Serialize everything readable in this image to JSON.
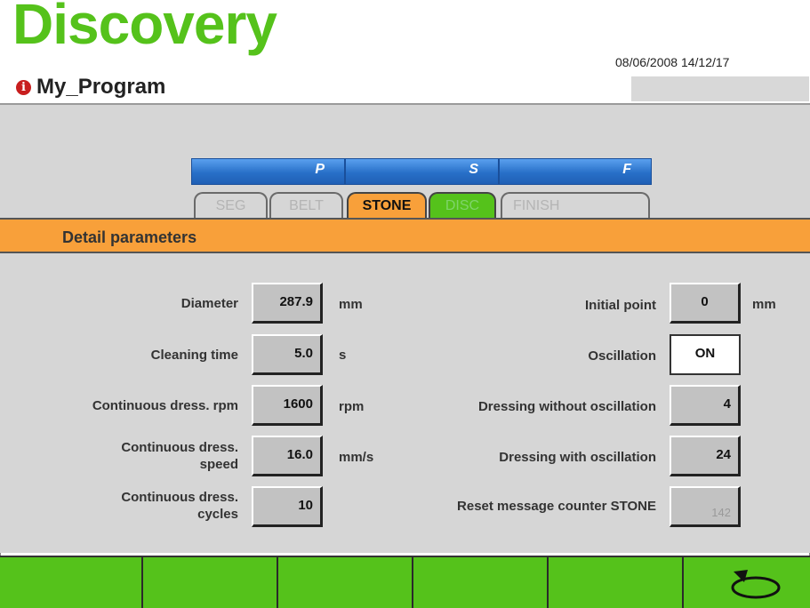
{
  "app": {
    "title": "Discovery"
  },
  "program": {
    "name": "My_Program",
    "icon": "info-icon"
  },
  "datetime": "08/06/2008 14/12/17",
  "tab_groups": [
    {
      "label": "P"
    },
    {
      "label": "S"
    },
    {
      "label": "F"
    }
  ],
  "tabs": [
    {
      "label": "SEG",
      "state": "inactive"
    },
    {
      "label": "BELT",
      "state": "inactive"
    },
    {
      "label": "STONE",
      "state": "active"
    },
    {
      "label": "DISC",
      "state": "inactive-green"
    },
    {
      "label": "FINISH",
      "state": "inactive"
    }
  ],
  "section_title": "Detail parameters",
  "left_params": [
    {
      "label": "Diameter",
      "value": "287.9",
      "unit": "mm"
    },
    {
      "label": "Cleaning time",
      "value": "5.0",
      "unit": "s"
    },
    {
      "label": "Continuous dress. rpm",
      "value": "1600",
      "unit": "rpm"
    },
    {
      "label_line1": "Continuous dress.",
      "label_line2": "speed",
      "value": "16.0",
      "unit": "mm/s"
    },
    {
      "label_line1": "Continuous dress.",
      "label_line2": "cycles",
      "value": "10",
      "unit": ""
    }
  ],
  "right_params": [
    {
      "label": "Initial point",
      "value": "0",
      "unit": "mm"
    },
    {
      "label": "Oscillation",
      "value": "ON"
    },
    {
      "label": "Dressing without oscillation",
      "value": "4"
    },
    {
      "label": "Dressing with oscillation",
      "value": "24"
    },
    {
      "label": "Reset message counter STONE",
      "value": "142"
    }
  ],
  "bottom_bar": {
    "back_icon": "back-arrow-icon"
  },
  "colors": {
    "brand_green": "#55c21b",
    "orange": "#f8a03a",
    "blue": "#2870c8",
    "gray": "#d6d6d6"
  }
}
